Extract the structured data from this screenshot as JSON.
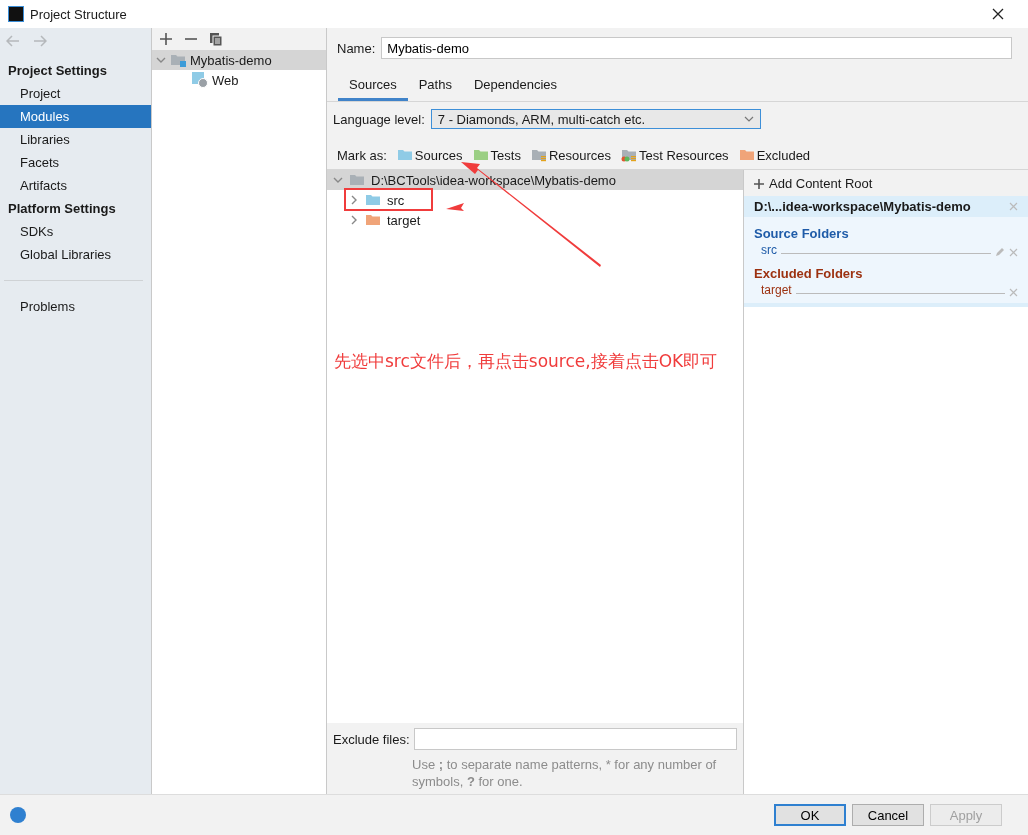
{
  "window": {
    "title": "Project Structure"
  },
  "sidebar": {
    "sections": [
      {
        "heading": "Project Settings",
        "items": [
          {
            "label": "Project",
            "selected": false
          },
          {
            "label": "Modules",
            "selected": true
          },
          {
            "label": "Libraries",
            "selected": false
          },
          {
            "label": "Facets",
            "selected": false
          },
          {
            "label": "Artifacts",
            "selected": false
          }
        ]
      },
      {
        "heading": "Platform Settings",
        "items": [
          {
            "label": "SDKs",
            "selected": false
          },
          {
            "label": "Global Libraries",
            "selected": false
          }
        ]
      }
    ],
    "extra_items": [
      {
        "label": "Problems",
        "selected": false
      }
    ]
  },
  "module_tree": [
    {
      "label": "Mybatis-demo",
      "kind": "module",
      "expanded": true,
      "selected": true,
      "children": [
        {
          "label": "Web",
          "kind": "web",
          "selected": false
        }
      ]
    }
  ],
  "name_field": {
    "label": "Name:",
    "value": "Mybatis-demo"
  },
  "tabs": [
    {
      "label": "Sources",
      "selected": true
    },
    {
      "label": "Paths",
      "selected": false
    },
    {
      "label": "Dependencies",
      "selected": false
    }
  ],
  "language_level": {
    "label": "Language level:",
    "value": "7 - Diamonds, ARM, multi-catch etc."
  },
  "mark_as": {
    "label": "Mark as:",
    "buttons": [
      {
        "label": "Sources",
        "kind": "sources"
      },
      {
        "label": "Tests",
        "kind": "tests"
      },
      {
        "label": "Resources",
        "kind": "resources"
      },
      {
        "label": "Test Resources",
        "kind": "test_resources"
      },
      {
        "label": "Excluded",
        "kind": "excluded"
      }
    ]
  },
  "source_tree": {
    "label": "D:\\BCTools\\idea-workspace\\Mybatis-demo",
    "kind": "root",
    "expanded": true,
    "selected": true,
    "children": [
      {
        "label": "src",
        "kind": "sources",
        "expanded": false,
        "selected": false
      },
      {
        "label": "target",
        "kind": "excluded",
        "expanded": false,
        "selected": false
      }
    ]
  },
  "annotation": {
    "text": "先选中src文件后，再点击source,接着点击OK即可"
  },
  "content_root": {
    "add_button": "Add Content Root",
    "path": "D:\\...idea-workspace\\Mybatis-demo",
    "groups": [
      {
        "heading": "Source Folders",
        "kind": "sources",
        "folders": [
          {
            "label": "src",
            "editable": true
          }
        ]
      },
      {
        "heading": "Excluded Folders",
        "kind": "excluded",
        "folders": [
          {
            "label": "target",
            "editable": false
          }
        ]
      }
    ]
  },
  "exclude_files": {
    "label": "Exclude files:",
    "hint": "Use **;** to separate name patterns, * for any number of symbols, **?** for one."
  },
  "buttons": [
    {
      "label": "OK",
      "default": true,
      "disabled": false
    },
    {
      "label": "Cancel",
      "default": false,
      "disabled": false
    },
    {
      "label": "Apply",
      "default": false,
      "disabled": true
    }
  ]
}
